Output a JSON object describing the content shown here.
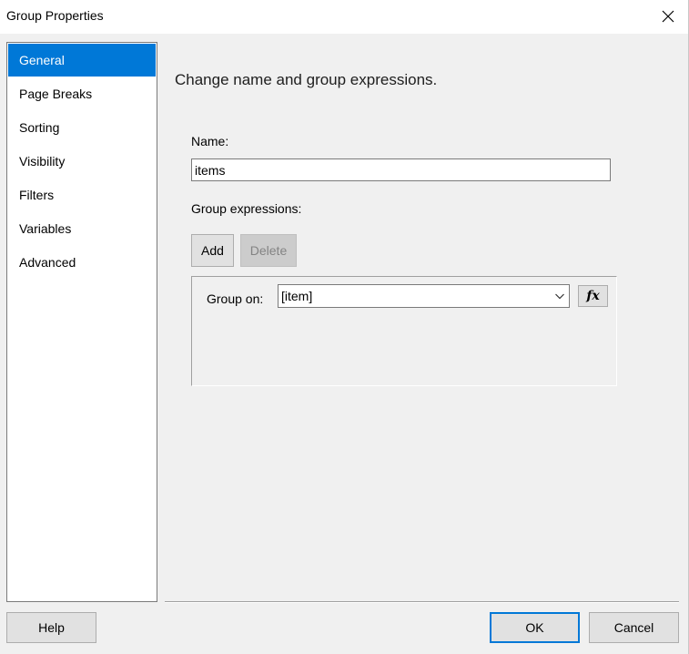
{
  "window": {
    "title": "Group Properties"
  },
  "sidebar": {
    "items": [
      {
        "label": "General",
        "active": true
      },
      {
        "label": "Page Breaks",
        "active": false
      },
      {
        "label": "Sorting",
        "active": false
      },
      {
        "label": "Visibility",
        "active": false
      },
      {
        "label": "Filters",
        "active": false
      },
      {
        "label": "Variables",
        "active": false
      },
      {
        "label": "Advanced",
        "active": false
      }
    ]
  },
  "main": {
    "heading": "Change name and group expressions.",
    "name_label": "Name:",
    "name_value": "items",
    "group_expressions_label": "Group expressions:",
    "add_label": "Add",
    "delete_label": "Delete",
    "group_on_label": "Group on:",
    "group_on_value": "[item]",
    "fx_label": "fx"
  },
  "footer": {
    "help_label": "Help",
    "ok_label": "OK",
    "cancel_label": "Cancel"
  },
  "colors": {
    "accent": "#0078d7",
    "dialog_bg": "#f0f0f0",
    "button_bg": "#e1e1e1",
    "disabled_text": "#838383"
  }
}
